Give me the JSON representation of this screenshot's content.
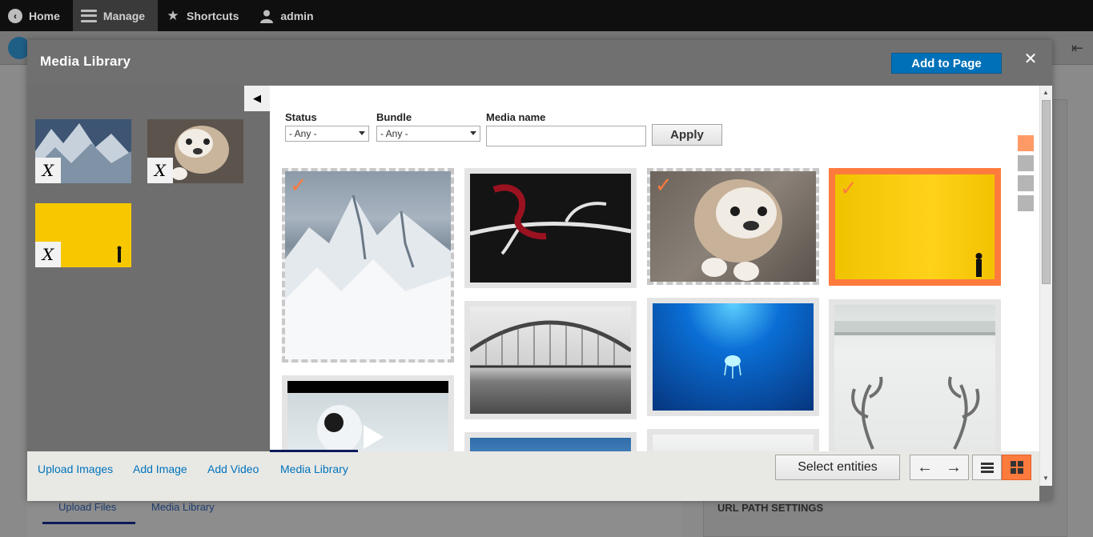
{
  "toolbar": {
    "home": "Home",
    "manage": "Manage",
    "shortcuts": "Shortcuts",
    "user": "admin"
  },
  "background": {
    "tab_upload": "Upload Files",
    "tab_media": "Media Library",
    "url_settings": "URL PATH SETTINGS"
  },
  "dialog": {
    "title": "Media Library",
    "add_to_page": "Add to Page",
    "close": "✕"
  },
  "selection": {
    "remove_glyph": "X",
    "toggle_glyph": "◀",
    "items": [
      {
        "name": "mountain"
      },
      {
        "name": "bulldog"
      },
      {
        "name": "yellow-wall"
      }
    ]
  },
  "filters": {
    "status_label": "Status",
    "status_value": "- Any -",
    "bundle_label": "Bundle",
    "bundle_value": "- Any -",
    "media_name_label": "Media name",
    "media_name_value": "",
    "apply": "Apply"
  },
  "bottombar": {
    "links": [
      "Upload Images",
      "Add Image",
      "Add Video",
      "Media Library"
    ],
    "select_entities": "Select entities",
    "prev": "←",
    "next": "→"
  },
  "colors": {
    "accent": "#ff7a3d",
    "primary_button": "#0071b8",
    "link": "#0074bd"
  }
}
